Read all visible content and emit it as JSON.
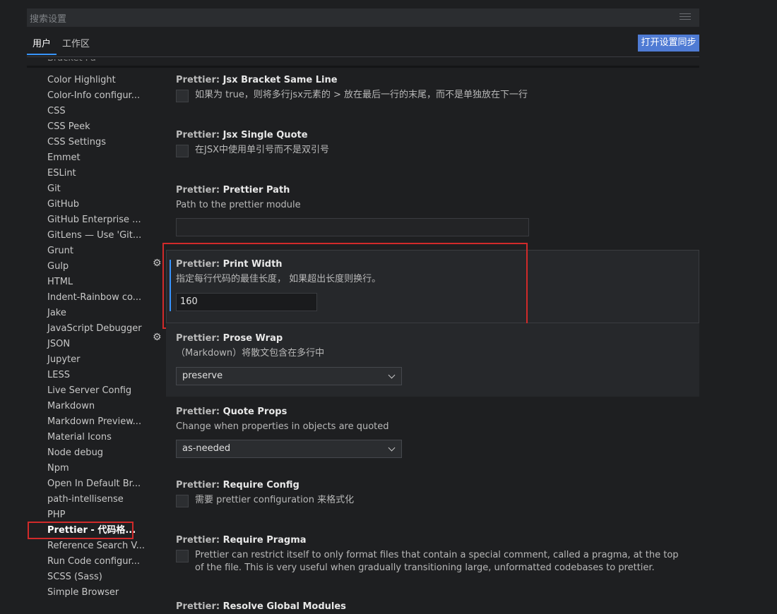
{
  "search": {
    "placeholder": "搜索设置"
  },
  "tabs": [
    {
      "label": "用户"
    },
    {
      "label": "工作区"
    }
  ],
  "sync_button": {
    "label": "打开设置同步"
  },
  "toc": {
    "partial_top": "Bracket Pa",
    "items": [
      "Color Highlight",
      "Color-Info configur...",
      "CSS",
      "CSS Peek",
      "CSS Settings",
      "Emmet",
      "ESLint",
      "Git",
      "GitHub",
      "GitHub Enterprise ...",
      "GitLens — Use 'Git...",
      "Grunt",
      "Gulp",
      "HTML",
      "Indent-Rainbow co...",
      "Jake",
      "JavaScript Debugger",
      "JSON",
      "Jupyter",
      "LESS",
      "Live Server Config",
      "Markdown",
      "Markdown Preview...",
      "Material Icons",
      "Node debug",
      "Npm",
      "Open In Default Br...",
      "path-intellisense",
      "PHP",
      "Prettier - 代码格...",
      "Reference Search V...",
      "Run Code configur...",
      "SCSS (Sass)",
      "Simple Browser"
    ],
    "active_label": "Prettier - 代码格..."
  },
  "settings": {
    "jsx_bracket": {
      "category": "Prettier: ",
      "name": "Jsx Bracket Same Line",
      "checkbox_text": "如果为 true，则将多行jsx元素的 > 放在最后一行的末尾，而不是单独放在下一行",
      "checked": false
    },
    "jsx_quote": {
      "category": "Prettier: ",
      "name": "Jsx Single Quote",
      "checkbox_text": "在JSX中使用单引号而不是双引号",
      "checked": false
    },
    "prettier_path": {
      "category": "Prettier: ",
      "name": "Prettier Path",
      "description": "Path to the prettier module",
      "value": ""
    },
    "print_width": {
      "category": "Prettier: ",
      "name": "Print Width",
      "description": "指定每行代码的最佳长度， 如果超出长度则换行。",
      "value": "160"
    },
    "prose_wrap": {
      "category": "Prettier: ",
      "name": "Prose Wrap",
      "description": "（Markdown）将散文包含在多行中",
      "value": "preserve"
    },
    "quote_props": {
      "category": "Prettier: ",
      "name": "Quote Props",
      "description": "Change when properties in objects are quoted",
      "value": "as-needed"
    },
    "require_config": {
      "category": "Prettier: ",
      "name": "Require Config",
      "checkbox_text": "需要 prettier configuration 来格式化",
      "checked": false
    },
    "require_pragma": {
      "category": "Prettier: ",
      "name": "Require Pragma",
      "checkbox_text": "Prettier can restrict itself to only format files that contain a special comment, called a pragma, at the top of the file. This is very useful when gradually transitioning large, unformatted codebases to prettier.",
      "checked": false
    },
    "partial_bottom": {
      "category": "Prettier: ",
      "name": "Resolve Global Modules"
    }
  },
  "icons": {
    "gear": "gear-icon",
    "filter": "filter-icon",
    "chevron": "chevron-down-icon"
  },
  "colors": {
    "accent": "#3794ff",
    "sync_button": "#4f7bd4",
    "highlight": "#d12a2a"
  }
}
